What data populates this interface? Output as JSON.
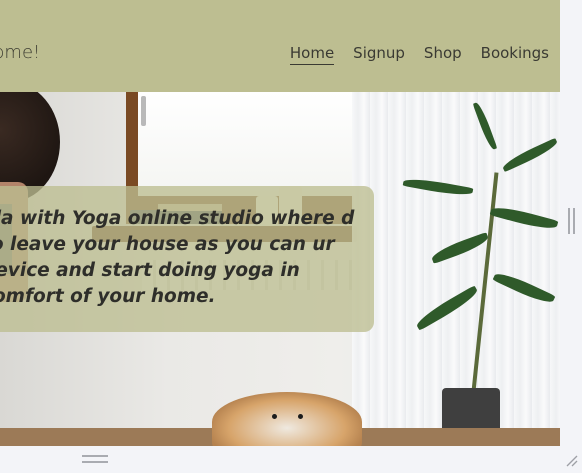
{
  "header": {
    "brand": "home!",
    "nav": [
      "Home",
      "Signup",
      "Shop",
      "Bookings"
    ],
    "active": "Home"
  },
  "hero": {
    "text": "ola with Yoga online studio where d to leave your house as you can ur device and start doing yoga in comfort of your home."
  },
  "colors": {
    "header_bg": "#bdbe91",
    "text": "#3a3a33",
    "overlay": "#bdbe91"
  },
  "icons": {
    "resize": "resize-grip-icon"
  }
}
